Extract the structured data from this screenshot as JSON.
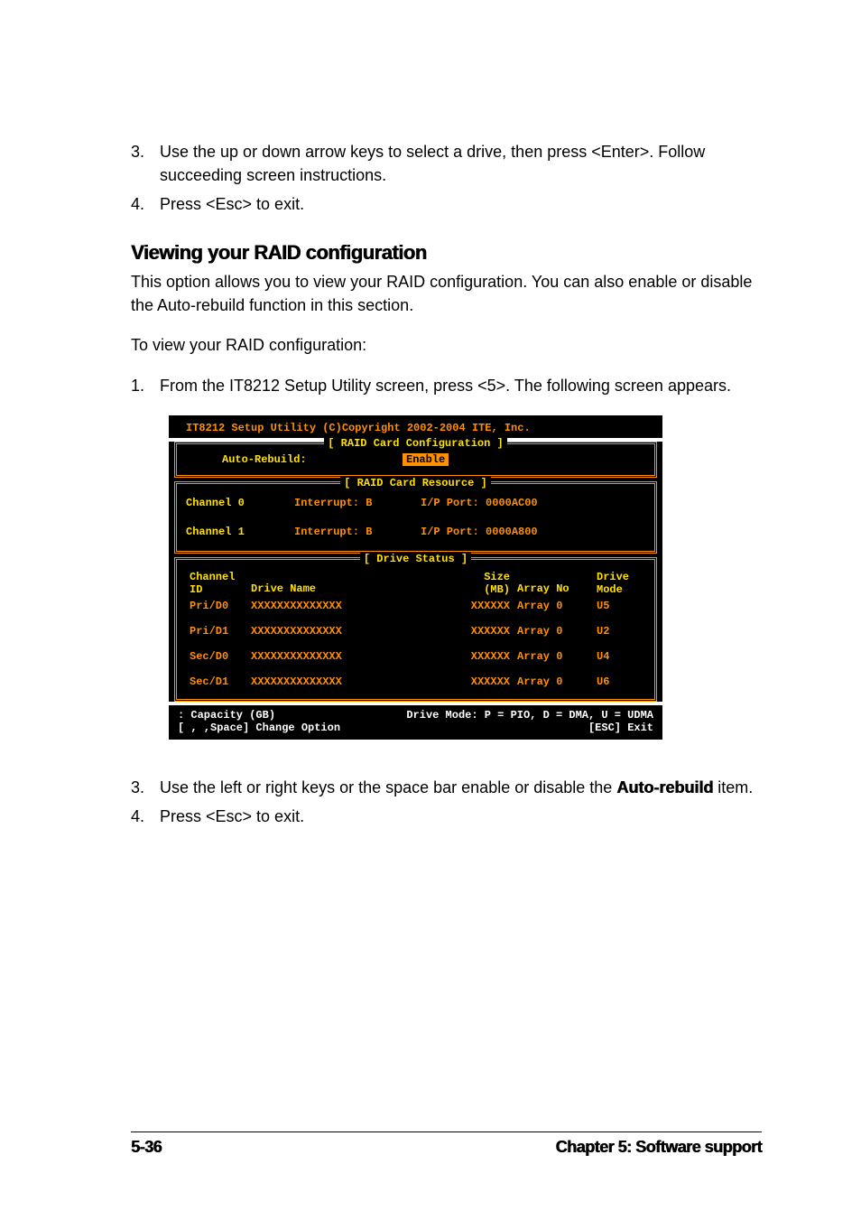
{
  "steps_top": [
    {
      "num": "3.",
      "text": "Use the up or down arrow keys to select a drive, then press <Enter>. Follow succeeding screen instructions."
    },
    {
      "num": "4.",
      "text": "Press <Esc> to exit."
    }
  ],
  "heading": "Viewing your RAID configuration",
  "para1": "This option allows you to view your RAID configuration. You can also enable or disable the Auto-rebuild function in this section.",
  "para2": "To view your RAID configuration:",
  "steps_mid": [
    {
      "num": "1.",
      "text": "From the IT8212 Setup Utility screen, press <5>. The following screen appears."
    }
  ],
  "term": {
    "title": "IT8212 Setup Utility (C)Copyright 2002-2004 ITE, Inc.",
    "config": {
      "legend": "[ RAID Card Configuration ]",
      "label": "Auto-Rebuild:",
      "value": "Enable"
    },
    "resource": {
      "legend": "[ RAID Card Resource ]",
      "rows": [
        {
          "ch": "Channel 0",
          "int": "Interrupt: B",
          "port": "I/P Port: 0000AC00"
        },
        {
          "ch": "Channel 1",
          "int": "Interrupt: B",
          "port": "I/P Port: 0000A800"
        }
      ]
    },
    "status": {
      "legend": "[ Drive Status ]",
      "head": {
        "c1a": "Channel",
        "c1b": "ID",
        "c2": "Drive Name",
        "c3a": "Size",
        "c3b": "(MB)",
        "c4": "Array No",
        "c5a": "Drive",
        "c5b": "Mode"
      },
      "rows": [
        {
          "id": "Pri/D0",
          "name": "XXXXXXXXXXXXXX",
          "size": "XXXXXX",
          "arr": "Array 0",
          "mode": "U5"
        },
        {
          "id": "Pri/D1",
          "name": "XXXXXXXXXXXXXX",
          "size": "XXXXXX",
          "arr": "Array 0",
          "mode": "U2"
        },
        {
          "id": "Sec/D0",
          "name": "XXXXXXXXXXXXXX",
          "size": "XXXXXX",
          "arr": "Array 0",
          "mode": "U4"
        },
        {
          "id": "Sec/D1",
          "name": "XXXXXXXXXXXXXX",
          "size": "XXXXXX",
          "arr": "Array 0",
          "mode": "U6"
        }
      ]
    },
    "foot": {
      "l1_left": ": Capacity (GB)",
      "l1_right": "Drive Mode: P = PIO, D = DMA, U = UDMA",
      "l2_left": "[ , ,Space] Change Option",
      "l2_right": "[ESC] Exit"
    }
  },
  "steps_bottom": [
    {
      "num": "3.",
      "text_a": "Use the left or right keys or the space bar enable or disable the ",
      "bold": "Auto-rebuild",
      "text_b": " item."
    },
    {
      "num": "4.",
      "text": "Press <Esc> to exit."
    }
  ],
  "footer": {
    "left": "5-36",
    "right": "Chapter 5: Software support"
  }
}
